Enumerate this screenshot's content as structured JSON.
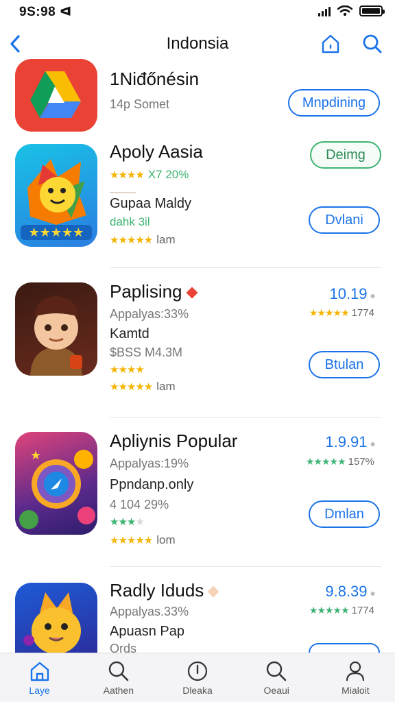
{
  "status_bar": {
    "time": "9S:98 ᐊ"
  },
  "nav": {
    "title": "Indonsia"
  },
  "apps": [
    {
      "name": "1Niđőnésin",
      "subtitle": "14p Somet",
      "button": "Mnpdining"
    },
    {
      "name": "Apoly Aasia",
      "rating_text": "X7 20%",
      "sub_name": "Gupaa Maldy",
      "sub_note": "dahk 3il",
      "rating2_text": "lam",
      "button_top": "Deimg",
      "button": "Dvlani"
    },
    {
      "name": "Paplising",
      "line1": "Appalyas:33%",
      "line2": "Kamtd",
      "line3": "$BSS M4.3M",
      "rating_text": "lam",
      "price": "10.19",
      "side_rating": "1774",
      "button": "Btulan"
    },
    {
      "name": "Apliynis Popular",
      "line1": "Appalyas:19%",
      "line2": "Ppndanp.only",
      "line3": "4 104 29%",
      "rating_text": "lom",
      "price": "1.9.91",
      "side_rating": "157%",
      "button": "Dmlan"
    },
    {
      "name": "Radly Iduds",
      "line1": "Appalyas.33%",
      "line2": "Apuasn Pap",
      "line3": "Ords",
      "price": "9.8.39",
      "side_rating": "1774"
    }
  ],
  "tabs": [
    {
      "label": "Laye"
    },
    {
      "label": "Aathen"
    },
    {
      "label": "Dleaka"
    },
    {
      "label": "Oeaui"
    },
    {
      "label": "Mialoit"
    }
  ],
  "colors": {
    "accent": "#1a73e8",
    "star": "#f4b400",
    "green": "#3cb371"
  }
}
